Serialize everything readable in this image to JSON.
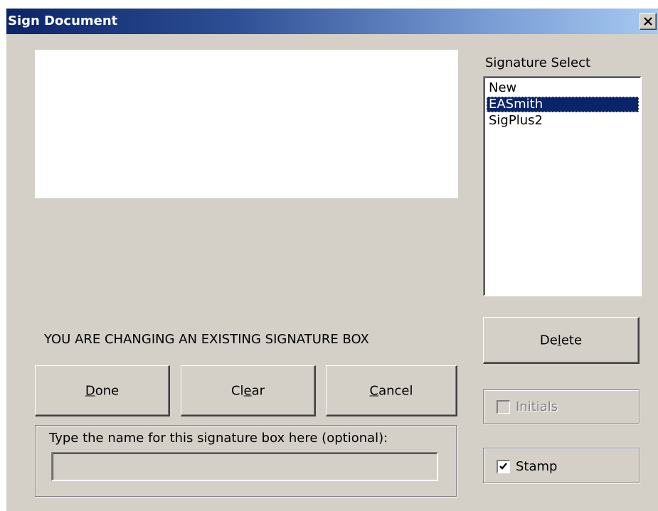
{
  "window": {
    "title": "Sign Document"
  },
  "signature_select": {
    "label": "Signature Select",
    "items": [
      "New",
      "EASmith",
      "SigPlus2"
    ],
    "selected": "EASmith"
  },
  "status_message": "YOU ARE CHANGING AN EXISTING SIGNATURE BOX",
  "buttons": {
    "delete": {
      "pre": "De",
      "mnemonic": "l",
      "post": "ete"
    },
    "done": {
      "pre": "",
      "mnemonic": "D",
      "post": "one"
    },
    "clear": {
      "pre": "Cl",
      "mnemonic": "e",
      "post": "ar"
    },
    "cancel": {
      "pre": "",
      "mnemonic": "C",
      "post": "ancel"
    }
  },
  "name_group": {
    "label": "Type the name for this signature box here (optional):",
    "value": ""
  },
  "options": {
    "initials": {
      "label": "Initials",
      "checked": false,
      "enabled": false
    },
    "stamp": {
      "label": "Stamp",
      "checked": true,
      "enabled": true
    }
  },
  "colors": {
    "dialog_bg": "#d4d0c8",
    "titlebar_start": "#0a246a",
    "titlebar_end": "#a6caf0",
    "selection": "#0a246a"
  },
  "icons": {
    "close": "close-icon",
    "check": "checkmark-icon"
  }
}
